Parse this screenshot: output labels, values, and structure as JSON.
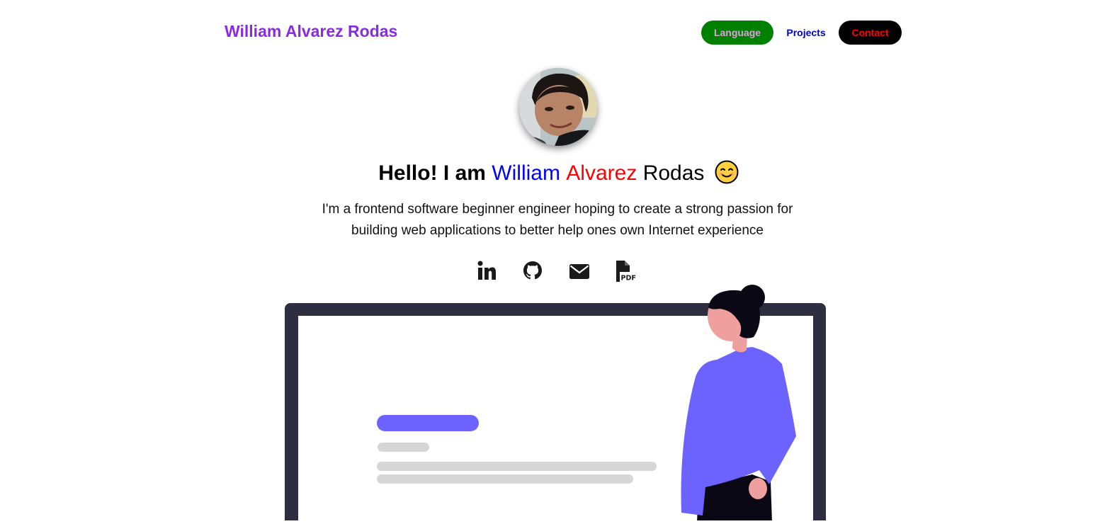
{
  "nav": {
    "brand": "William Alvarez Rodas",
    "links": [
      "Language",
      "Projects",
      "Contact"
    ]
  },
  "hero": {
    "greeting_prefix": "Hello! I am",
    "name_first": "William",
    "name_middle": "Alvarez",
    "name_last": "Rodas",
    "bio": "I'm a frontend software beginner engineer hoping to create a strong passion for building web applications to better help ones own Internet experience"
  },
  "socials": [
    {
      "icon": "linkedin-icon"
    },
    {
      "icon": "github-icon"
    },
    {
      "icon": "envelope-icon"
    },
    {
      "icon": "pdf-file-icon"
    }
  ],
  "colors": {
    "brand": "#8a2be2",
    "language_bg": "#008000",
    "language_text": "#dda0dd",
    "projects_text": "#0000cd",
    "contact_bg": "#000000",
    "contact_text": "#ff0000",
    "name_first": "#0000ff",
    "name_middle": "#ff0000",
    "illustration_accent": "#6c63ff"
  }
}
